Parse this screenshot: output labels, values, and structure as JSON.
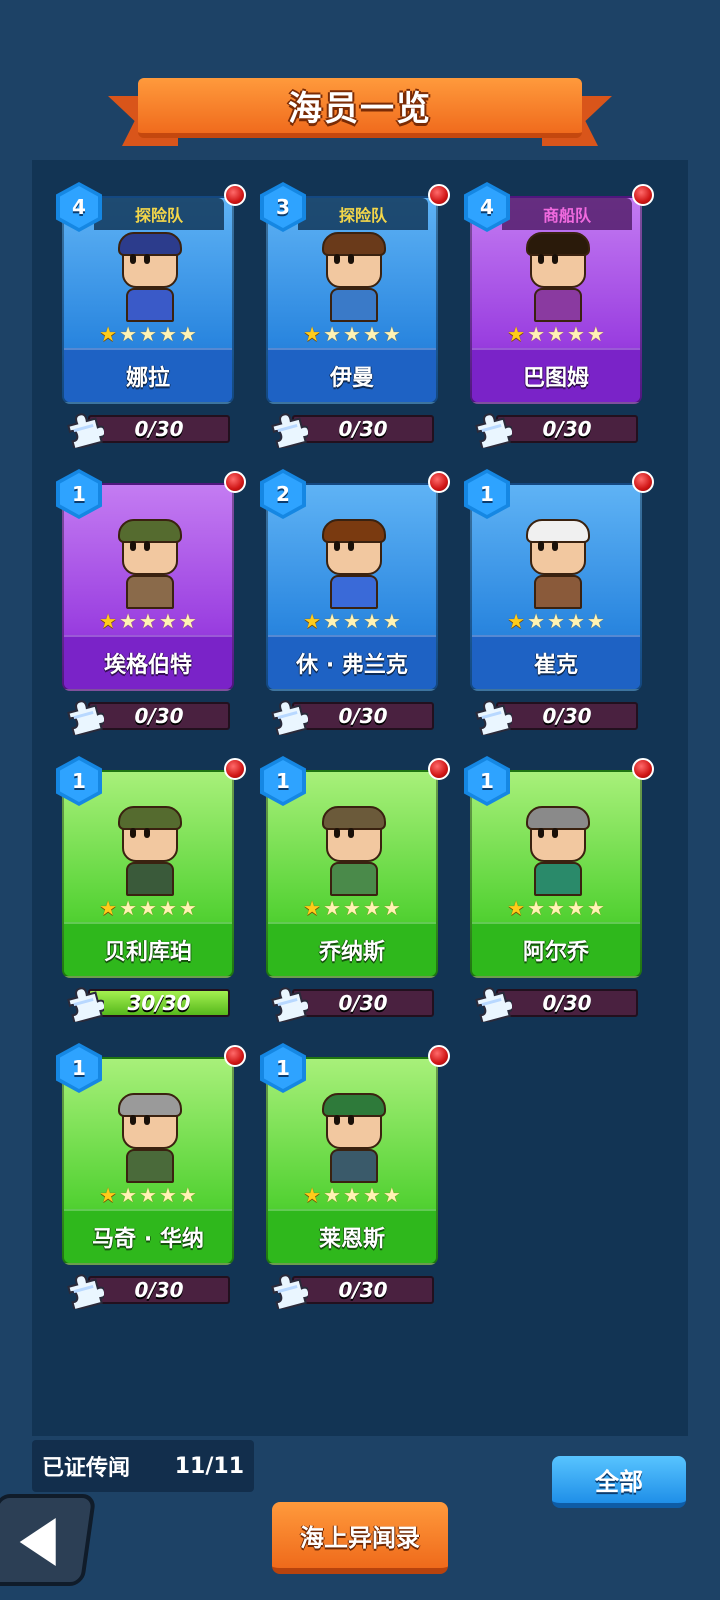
{
  "header": {
    "title": "海员一览"
  },
  "colors": {
    "blue_card": "#2a86df",
    "purple_card": "#9a3fe0",
    "green_card": "#54d234",
    "badge_red": "#d01616",
    "orange_accent": "#f06b1d"
  },
  "cards": [
    {
      "name": "娜拉",
      "level": "4",
      "team": "探险队",
      "rarity": "blue",
      "stars": 1,
      "fragments": "0/30",
      "progress": 0
    },
    {
      "name": "伊曼",
      "level": "3",
      "team": "探险队",
      "rarity": "blue",
      "stars": 1,
      "fragments": "0/30",
      "progress": 0
    },
    {
      "name": "巴图姆",
      "level": "4",
      "team": "商船队",
      "rarity": "purple",
      "stars": 1,
      "fragments": "0/30",
      "progress": 0
    },
    {
      "name": "埃格伯特",
      "level": "1",
      "team": "",
      "rarity": "purple",
      "stars": 1,
      "fragments": "0/30",
      "progress": 0
    },
    {
      "name": "休 · 弗兰克",
      "level": "2",
      "team": "",
      "rarity": "blue",
      "stars": 1,
      "fragments": "0/30",
      "progress": 0
    },
    {
      "name": "崔克",
      "level": "1",
      "team": "",
      "rarity": "blue",
      "stars": 1,
      "fragments": "0/30",
      "progress": 0
    },
    {
      "name": "贝利库珀",
      "level": "1",
      "team": "",
      "rarity": "green",
      "stars": 1,
      "fragments": "30/30",
      "progress": 1
    },
    {
      "name": "乔纳斯",
      "level": "1",
      "team": "",
      "rarity": "green",
      "stars": 1,
      "fragments": "0/30",
      "progress": 0
    },
    {
      "name": "阿尔乔",
      "level": "1",
      "team": "",
      "rarity": "green",
      "stars": 1,
      "fragments": "0/30",
      "progress": 0
    },
    {
      "name": "马奇 · 华纳",
      "level": "1",
      "team": "",
      "rarity": "green",
      "stars": 1,
      "fragments": "0/30",
      "progress": 0
    },
    {
      "name": "莱恩斯",
      "level": "1",
      "team": "",
      "rarity": "green",
      "stars": 1,
      "fragments": "0/30",
      "progress": 0
    }
  ],
  "footer": {
    "proven_label": "已证传闻",
    "proven_count": "11/11",
    "all_button": "全部",
    "story_button": "海上异闻录"
  }
}
